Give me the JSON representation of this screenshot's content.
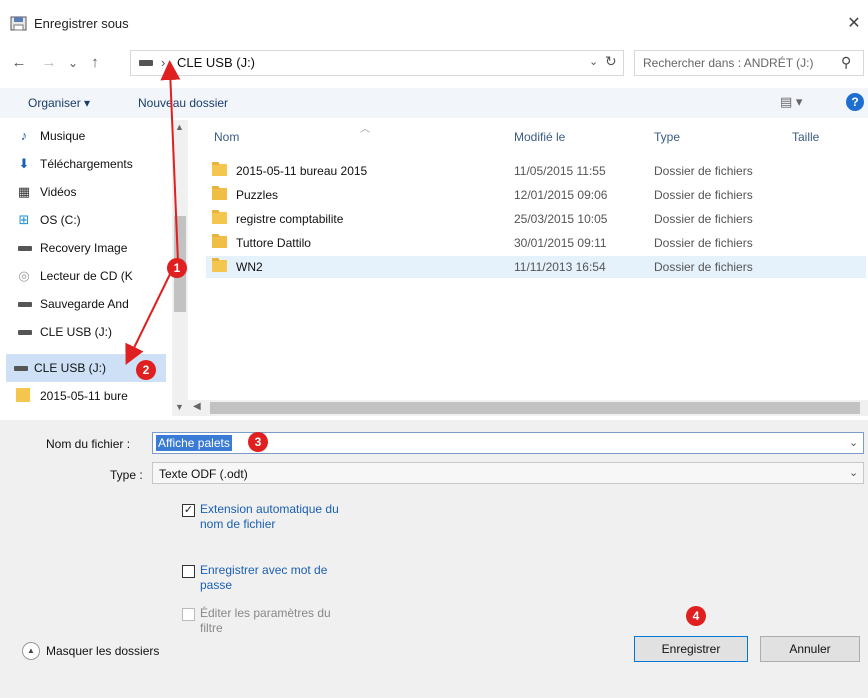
{
  "window": {
    "title": "Enregistrer sous",
    "close_glyph": "✕"
  },
  "nav": {
    "back_glyph": "←",
    "forward_glyph": "→",
    "recent_glyph": "⌄",
    "up_glyph": "↑",
    "address_sep": "›",
    "address": "CLE USB (J:)",
    "address_dd": "⌄",
    "refresh_glyph": "↻",
    "search_placeholder": "Rechercher dans : ANDRÉT (J:)",
    "search_glyph": "⚲"
  },
  "toolbar": {
    "organiser": "Organiser ▾",
    "nouveau_dossier": "Nouveau dossier",
    "view_glyph": "▤ ▾",
    "help_glyph": "?"
  },
  "sidebar": {
    "items": [
      {
        "label": "Musique",
        "icon": "music-icon",
        "glyph": "♪",
        "color": "#1a5fb4"
      },
      {
        "label": "Téléchargements",
        "icon": "download-icon",
        "glyph": "⬇",
        "color": "#1a5fb4"
      },
      {
        "label": "Vidéos",
        "icon": "video-icon",
        "glyph": "▦",
        "color": "#333333"
      },
      {
        "label": "OS (C:)",
        "icon": "windows-drive-icon",
        "glyph": "⊞",
        "color": "#1a8fd4"
      },
      {
        "label": "Recovery Image",
        "icon": "drive-icon",
        "glyph": "",
        "color": "#555555"
      },
      {
        "label": "Lecteur de CD (K",
        "icon": "cd-icon",
        "glyph": "◎",
        "color": "#999999"
      },
      {
        "label": "Sauvegarde And",
        "icon": "drive-icon",
        "glyph": "",
        "color": "#555555"
      },
      {
        "label": "CLE USB (J:)",
        "icon": "drive-icon",
        "glyph": "",
        "color": "#555555"
      },
      {
        "label": "CLE USB (J:)",
        "icon": "drive-icon",
        "glyph": "",
        "color": "#555555"
      },
      {
        "label": "2015-05-11 bure",
        "icon": "folder-icon",
        "glyph": "",
        "color": "#f5c64e"
      }
    ]
  },
  "files": {
    "columns": [
      "Nom",
      "Modifié le",
      "Type",
      "Taille"
    ],
    "rows": [
      {
        "name": "2015-05-11 bureau 2015",
        "date": "11/05/2015 11:55",
        "type": "Dossier de fichiers"
      },
      {
        "name": "Puzzles",
        "date": "12/01/2015 09:06",
        "type": "Dossier de fichiers"
      },
      {
        "name": "registre comptabilite",
        "date": "25/03/2015 10:05",
        "type": "Dossier de fichiers"
      },
      {
        "name": "Tuttore Dattilo",
        "date": "30/01/2015 09:11",
        "type": "Dossier de fichiers"
      },
      {
        "name": "WN2",
        "date": "11/11/2013 16:54",
        "type": "Dossier de fichiers"
      }
    ]
  },
  "form": {
    "filename_label": "Nom du fichier :",
    "filename_value": "Affiche palets",
    "type_label": "Type :",
    "type_value": "Texte ODF (.odt)",
    "checkbox_extension": "Extension automatique du nom de fichier",
    "checkbox_password": "Enregistrer avec mot de passe",
    "checkbox_filter": "Éditer les paramètres du filtre",
    "check_glyph": "✓"
  },
  "footer": {
    "masquer": "Masquer les dossiers",
    "save": "Enregistrer",
    "cancel": "Annuler"
  },
  "annotations": [
    "1",
    "2",
    "3",
    "4"
  ],
  "colors": {
    "accent": "#0078d7",
    "annotation": "#e02020",
    "selection": "#cde0f5"
  }
}
